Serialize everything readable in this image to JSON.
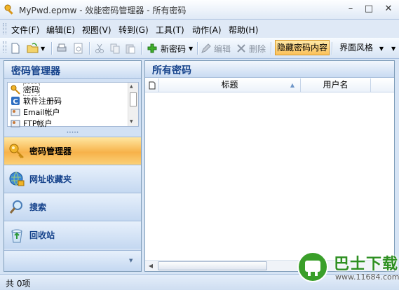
{
  "window": {
    "title": "MyPwd.epmw - 效能密码管理器 - 所有密码"
  },
  "menu": [
    "文件(F)",
    "编辑(E)",
    "视图(V)",
    "转到(G)",
    "工具(T)",
    "动作(A)",
    "帮助(H)"
  ],
  "toolbar": {
    "new_label": "新密码",
    "edit_label": "编辑",
    "delete_label": "删除",
    "hide_label": "隐藏密码内容",
    "style_label": "界面风格"
  },
  "left_panel": {
    "header": "密码管理器",
    "tree": [
      "密码",
      "软件注册码",
      "Email帐户",
      "FTP帐户"
    ],
    "nav": [
      "密码管理器",
      "网址收藏夹",
      "搜索",
      "回收站"
    ]
  },
  "main": {
    "header": "所有密码",
    "columns": [
      "标题",
      "用户名"
    ]
  },
  "status": {
    "text": "共 0项"
  },
  "watermark": {
    "title": "巴士下载",
    "url": "www.11684.com"
  },
  "colors": {
    "accent": "#f7b24a",
    "header_text": "#15428b",
    "frame": "#d6e4f5"
  }
}
